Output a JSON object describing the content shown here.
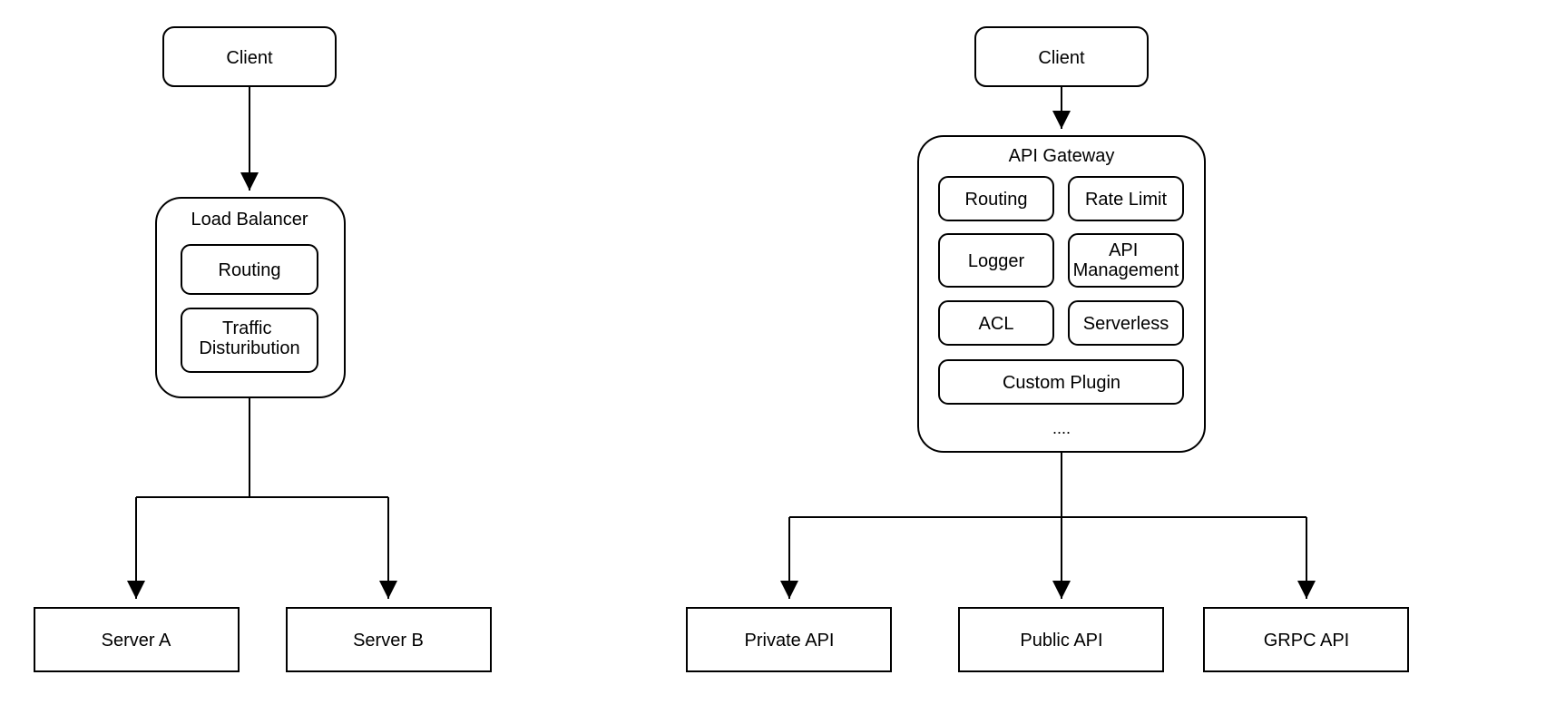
{
  "left": {
    "client": "Client",
    "middle": {
      "title": "Load Balancer",
      "items": [
        "Routing",
        "Traffic Disturibution"
      ]
    },
    "targets": [
      "Server A",
      "Server B"
    ]
  },
  "right": {
    "client": "Client",
    "middle": {
      "title": "API Gateway",
      "grid": [
        [
          "Routing",
          "Rate Limit"
        ],
        [
          "Logger",
          "API Management"
        ],
        [
          "ACL",
          "Serverless"
        ]
      ],
      "wide": "Custom Plugin",
      "ellipsis": "...."
    },
    "targets": [
      "Private API",
      "Public API",
      "GRPC API"
    ]
  }
}
